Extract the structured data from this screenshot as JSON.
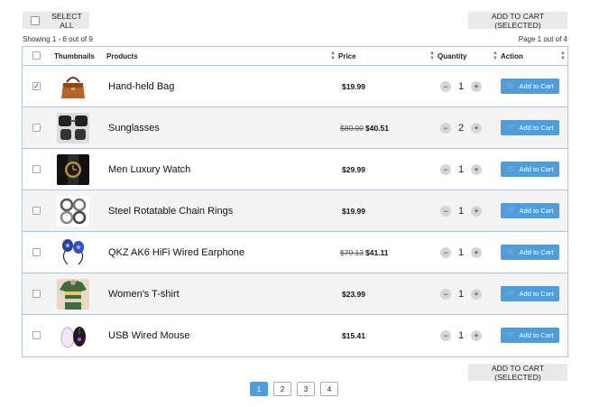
{
  "toolbar": {
    "select_all_label": "SELECT ALL",
    "add_to_cart_selected_label": "ADD TO CART (SELECTED)"
  },
  "summary": {
    "showing": "Showing 1 - 6 out of 9",
    "page_info": "Page 1 out of 4"
  },
  "table": {
    "headers": {
      "thumbnails": "Thumbnails",
      "products": "Products",
      "price": "Price",
      "quantity": "Quantity",
      "action": "Action"
    },
    "rows": [
      {
        "name": "Hand-held Bag",
        "old_price": "",
        "price": "$19.99",
        "qty": "1",
        "checked": true,
        "action": "Add to Cart",
        "thumb_icon": "handbag-icon"
      },
      {
        "name": "Sunglasses",
        "old_price": "$80.00",
        "price": "$40.51",
        "qty": "2",
        "checked": false,
        "action": "Add to Cart",
        "thumb_icon": "sunglasses-icon"
      },
      {
        "name": "Men Luxury Watch",
        "old_price": "",
        "price": "$29.99",
        "qty": "1",
        "checked": false,
        "action": "Add to Cart",
        "thumb_icon": "watch-icon"
      },
      {
        "name": "Steel Rotatable Chain Rings",
        "old_price": "",
        "price": "$19.99",
        "qty": "1",
        "checked": false,
        "action": "Add to Cart",
        "thumb_icon": "rings-icon"
      },
      {
        "name": "QKZ AK6 HiFi Wired Earphone",
        "old_price": "$70.13",
        "price": "$41.11",
        "qty": "1",
        "checked": false,
        "action": "Add to Cart",
        "thumb_icon": "earphone-icon"
      },
      {
        "name": "Women's T-shirt",
        "old_price": "",
        "price": "$23.99",
        "qty": "1",
        "checked": false,
        "action": "Add to Cart",
        "thumb_icon": "tshirt-icon"
      },
      {
        "name": "USB Wired Mouse",
        "old_price": "",
        "price": "$15.41",
        "qty": "1",
        "checked": false,
        "action": "Add to Cart",
        "thumb_icon": "mouse-icon"
      }
    ]
  },
  "pagination": {
    "pages": [
      "1",
      "2",
      "3",
      "4"
    ],
    "active": "1"
  },
  "colors": {
    "accent": "#4e9ede",
    "border": "#a9c6e4",
    "alt_row": "#f4f4f4"
  }
}
